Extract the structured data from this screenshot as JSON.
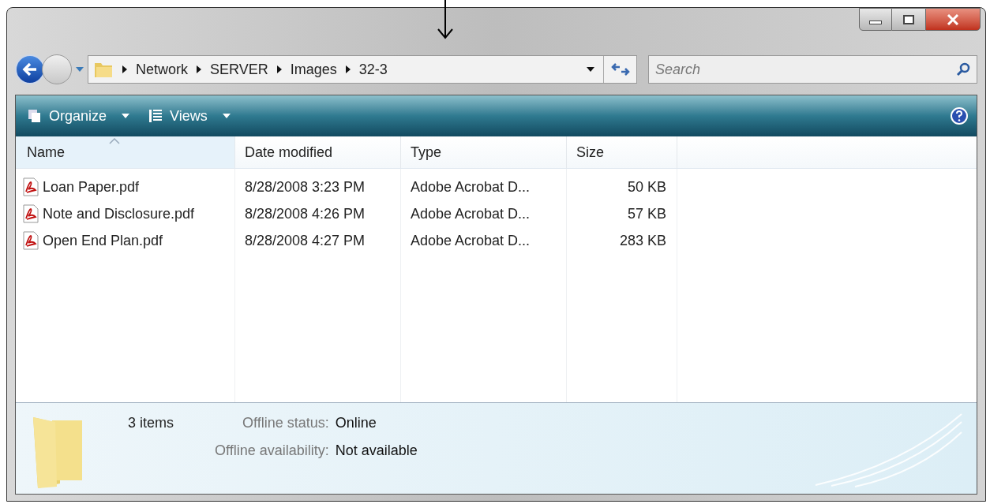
{
  "address_bar": {
    "breadcrumbs": [
      "Network",
      "SERVER",
      "Images",
      "32-3"
    ]
  },
  "search": {
    "placeholder": "Search"
  },
  "toolbar": {
    "buttons": [
      "Organize",
      "Views"
    ]
  },
  "file_list": {
    "columns": [
      "Name",
      "Date modified",
      "Type",
      "Size"
    ],
    "rows": [
      {
        "name": "Loan Paper.pdf",
        "date_modified": "8/28/2008 3:23 PM",
        "type": "Adobe Acrobat D...",
        "size": "50 KB"
      },
      {
        "name": "Note and Disclosure.pdf",
        "date_modified": "8/28/2008 4:26 PM",
        "type": "Adobe Acrobat D...",
        "size": "57 KB"
      },
      {
        "name": "Open End Plan.pdf",
        "date_modified": "8/28/2008 4:27 PM",
        "type": "Adobe Acrobat D...",
        "size": "283 KB"
      }
    ]
  },
  "details_pane": {
    "count": "3 items",
    "properties": [
      {
        "label": "Offline status:",
        "value": "Online"
      },
      {
        "label": "Offline availability:",
        "value": "Not available"
      }
    ]
  }
}
